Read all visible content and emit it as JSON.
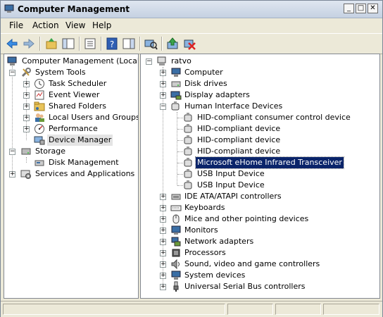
{
  "window": {
    "title": "Computer Management",
    "controls": {
      "minimize": "_",
      "maximize": "□",
      "close": "✕"
    }
  },
  "menu": [
    "File",
    "Action",
    "View",
    "Help"
  ],
  "toolbar": {
    "icons": [
      "back-icon",
      "forward-icon",
      "up-icon",
      "show-hide-tree-icon",
      "properties-icon",
      "help-icon",
      "action-pane-icon",
      "scan-hardware-icon",
      "update-driver-icon",
      "uninstall-icon"
    ]
  },
  "left_tree": [
    {
      "label": "Computer Management (Local)",
      "level": 0,
      "toggle": "",
      "icon": "computer-management-icon"
    },
    {
      "label": "System Tools",
      "level": 1,
      "toggle": "−",
      "icon": "system-tools-icon"
    },
    {
      "label": "Task Scheduler",
      "level": 2,
      "toggle": "+",
      "icon": "task-scheduler-icon"
    },
    {
      "label": "Event Viewer",
      "level": 2,
      "toggle": "+",
      "icon": "event-viewer-icon"
    },
    {
      "label": "Shared Folders",
      "level": 2,
      "toggle": "+",
      "icon": "shared-folders-icon"
    },
    {
      "label": "Local Users and Groups",
      "level": 2,
      "toggle": "+",
      "icon": "users-groups-icon"
    },
    {
      "label": "Performance",
      "level": 2,
      "toggle": "+",
      "icon": "performance-icon"
    },
    {
      "label": "Device Manager",
      "level": 2,
      "toggle": "",
      "icon": "device-manager-icon",
      "selected": true
    },
    {
      "label": "Storage",
      "level": 1,
      "toggle": "−",
      "icon": "storage-icon"
    },
    {
      "label": "Disk Management",
      "level": 2,
      "toggle": "",
      "icon": "disk-management-icon"
    },
    {
      "label": "Services and Applications",
      "level": 1,
      "toggle": "+",
      "icon": "services-icon"
    }
  ],
  "right_tree": [
    {
      "label": "ratvo",
      "level": 0,
      "toggle": "−",
      "icon": "computer-root-icon"
    },
    {
      "label": "Computer",
      "level": 1,
      "toggle": "+",
      "icon": "computer-icon"
    },
    {
      "label": "Disk drives",
      "level": 1,
      "toggle": "+",
      "icon": "disk-drive-icon"
    },
    {
      "label": "Display adapters",
      "level": 1,
      "toggle": "+",
      "icon": "display-adapter-icon"
    },
    {
      "label": "Human Interface Devices",
      "level": 1,
      "toggle": "−",
      "icon": "hid-icon"
    },
    {
      "label": "HID-compliant consumer control device",
      "level": 2,
      "toggle": "",
      "icon": "hid-device-icon"
    },
    {
      "label": "HID-compliant device",
      "level": 2,
      "toggle": "",
      "icon": "hid-device-icon"
    },
    {
      "label": "HID-compliant device",
      "level": 2,
      "toggle": "",
      "icon": "hid-device-icon"
    },
    {
      "label": "HID-compliant device",
      "level": 2,
      "toggle": "",
      "icon": "hid-device-icon"
    },
    {
      "label": "Microsoft eHome Infrared Transceiver",
      "level": 2,
      "toggle": "",
      "icon": "hid-device-icon",
      "selected": true
    },
    {
      "label": "USB Input Device",
      "level": 2,
      "toggle": "",
      "icon": "hid-device-icon"
    },
    {
      "label": "USB Input Device",
      "level": 2,
      "toggle": "",
      "icon": "hid-device-icon"
    },
    {
      "label": "IDE ATA/ATAPI controllers",
      "level": 1,
      "toggle": "+",
      "icon": "ide-controller-icon"
    },
    {
      "label": "Keyboards",
      "level": 1,
      "toggle": "+",
      "icon": "keyboard-icon"
    },
    {
      "label": "Mice and other pointing devices",
      "level": 1,
      "toggle": "+",
      "icon": "mouse-icon"
    },
    {
      "label": "Monitors",
      "level": 1,
      "toggle": "+",
      "icon": "monitor-icon"
    },
    {
      "label": "Network adapters",
      "level": 1,
      "toggle": "+",
      "icon": "network-adapter-icon"
    },
    {
      "label": "Processors",
      "level": 1,
      "toggle": "+",
      "icon": "processor-icon"
    },
    {
      "label": "Sound, video and game controllers",
      "level": 1,
      "toggle": "+",
      "icon": "sound-icon"
    },
    {
      "label": "System devices",
      "level": 1,
      "toggle": "+",
      "icon": "system-devices-icon"
    },
    {
      "label": "Universal Serial Bus controllers",
      "level": 1,
      "toggle": "+",
      "icon": "usb-icon"
    }
  ],
  "colors": {
    "selection": "#0a246a",
    "inactive_selection": "#e4e4e4"
  }
}
